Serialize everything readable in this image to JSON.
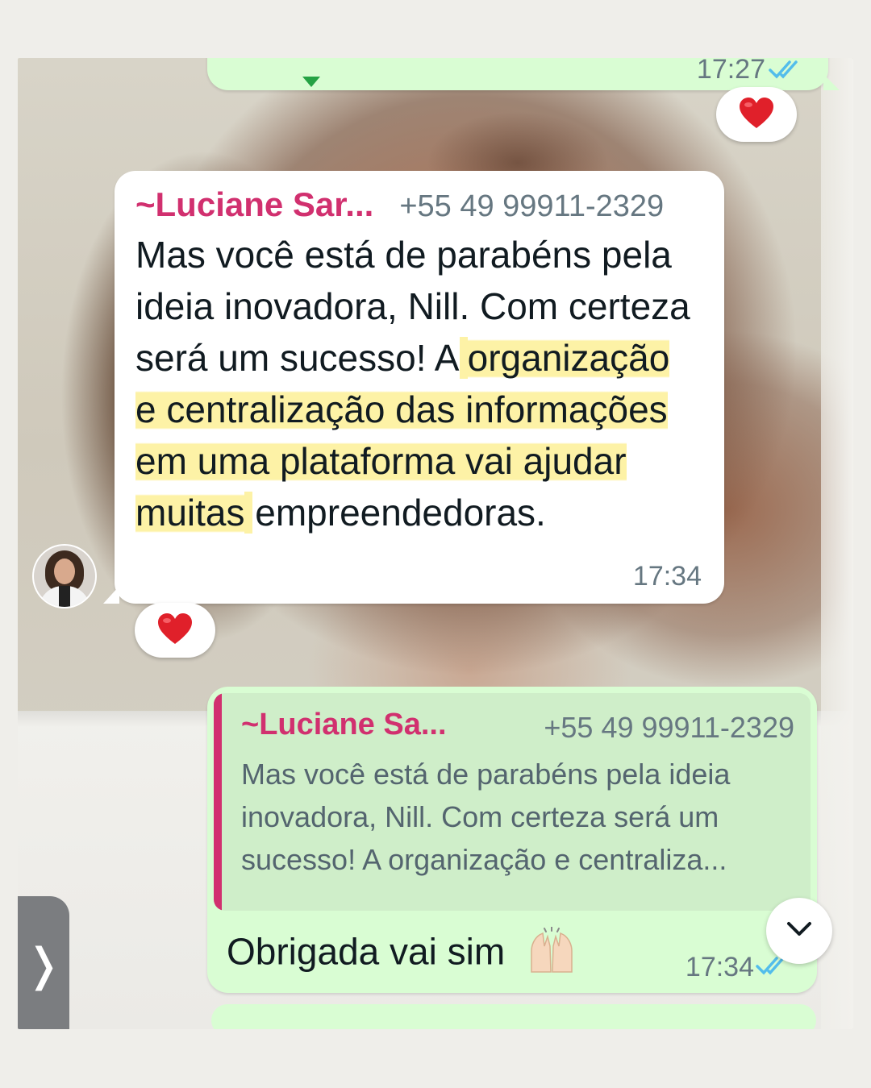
{
  "top_message": {
    "time": "17:27",
    "reaction": "❤️"
  },
  "incoming_message": {
    "sender_name": "~Luciane Sar...",
    "sender_phone": "+55 49 99911-2329",
    "text_plain": "Mas você está de parabéns pela ideia inovadora, Nill. Com certeza será um sucesso! A",
    "text_highlighted": "organização e centralização das informações em uma plataforma vai ajudar muitas",
    "text_tail": "empreendedoras.",
    "time": "17:34",
    "reaction": "❤️",
    "avatar": "avatar"
  },
  "reply_message": {
    "quoted": {
      "sender_name": "~Luciane Sa...",
      "sender_phone": "+55 49 99911-2329",
      "text": "Mas você está de parabéns pela ideia inovadora, Nill. Com certeza será um sucesso! A organização e centraliza..."
    },
    "text": "Obrigada vai sim",
    "emoji": "raising-hands-icon",
    "time": "17:34"
  },
  "controls": {
    "scroll_down_icon": "chevron-down-icon",
    "side_tab_glyph": "❭"
  },
  "colors": {
    "outgoing_bubble": "#d9fdd3",
    "incoming_bubble": "#ffffff",
    "sender_name": "#d1306f",
    "read_checks": "#53bdeb",
    "highlight": "#fdf19e"
  }
}
